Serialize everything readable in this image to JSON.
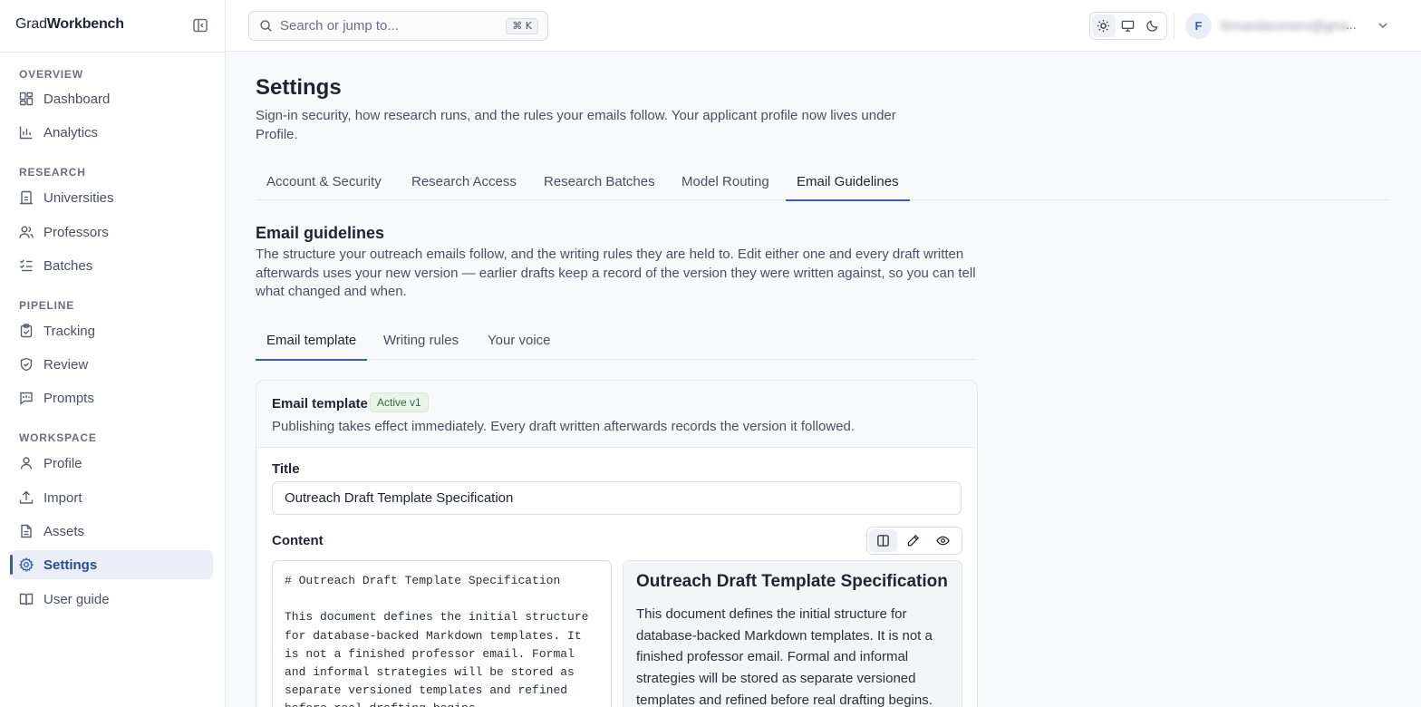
{
  "brand": {
    "part1": "Grad",
    "part2": "Workbench"
  },
  "sidebar": {
    "sections": [
      {
        "label": "OVERVIEW",
        "items": [
          {
            "label": "Dashboard",
            "icon": "dashboard-icon"
          },
          {
            "label": "Analytics",
            "icon": "chart-icon"
          }
        ]
      },
      {
        "label": "RESEARCH",
        "items": [
          {
            "label": "Universities",
            "icon": "building-icon"
          },
          {
            "label": "Professors",
            "icon": "users-icon"
          },
          {
            "label": "Batches",
            "icon": "list-check-icon"
          }
        ]
      },
      {
        "label": "PIPELINE",
        "items": [
          {
            "label": "Tracking",
            "icon": "clipboard-icon"
          },
          {
            "label": "Review",
            "icon": "shield-icon"
          },
          {
            "label": "Prompts",
            "icon": "message-icon"
          }
        ]
      },
      {
        "label": "WORKSPACE",
        "items": [
          {
            "label": "Profile",
            "icon": "user-icon"
          },
          {
            "label": "Import",
            "icon": "upload-icon"
          },
          {
            "label": "Assets",
            "icon": "file-icon"
          },
          {
            "label": "Settings",
            "icon": "gear-icon",
            "active": true
          },
          {
            "label": "User guide",
            "icon": "book-icon"
          }
        ]
      }
    ]
  },
  "topbar": {
    "search_placeholder": "Search or jump to...",
    "search_shortcut": "⌘ K",
    "avatar_initial": "F",
    "user_name": "fernandaromero@gmail.com",
    "user_ellipsis": "..."
  },
  "page": {
    "title": "Settings",
    "subtitle": "Sign-in security, how research runs, and the rules your emails follow. Your applicant profile now lives under Profile.",
    "tabs": [
      "Account & Security",
      "Research Access",
      "Research Batches",
      "Model Routing",
      "Email Guidelines"
    ],
    "active_tab": "Email Guidelines"
  },
  "guidelines": {
    "title": "Email guidelines",
    "description": "The structure your outreach emails follow, and the writing rules they are held to. Edit either one and every draft written afterwards uses your new version — earlier drafts keep a record of the version they were written against, so you can tell what changed and when.",
    "subtabs": [
      "Email template",
      "Writing rules",
      "Your voice"
    ],
    "active_subtab": "Email template"
  },
  "card": {
    "title": "Email template",
    "badge": "Active v1",
    "subtitle": "Publishing takes effect immediately. Every draft written afterwards records the version it followed.",
    "title_label": "Title",
    "title_value": "Outreach Draft Template Specification",
    "content_label": "Content",
    "editor_text": "# Outreach Draft Template Specification\n\nThis document defines the initial structure for database-backed Markdown templates. It is not a finished professor email. Formal and informal strategies will be stored as separate versioned templates and refined before real drafting begins.",
    "preview_heading": "Outreach Draft Template Specification",
    "preview_body": "This document defines the initial structure for database-backed Markdown templates. It is not a finished professor email. Formal and informal strategies will be stored as separate versioned templates and refined before real drafting begins."
  },
  "colors": {
    "accent": "#3a5bb0",
    "active_bg": "#eaeef8",
    "badge_bg": "#eaf4ea",
    "badge_text": "#2f6b3d"
  }
}
